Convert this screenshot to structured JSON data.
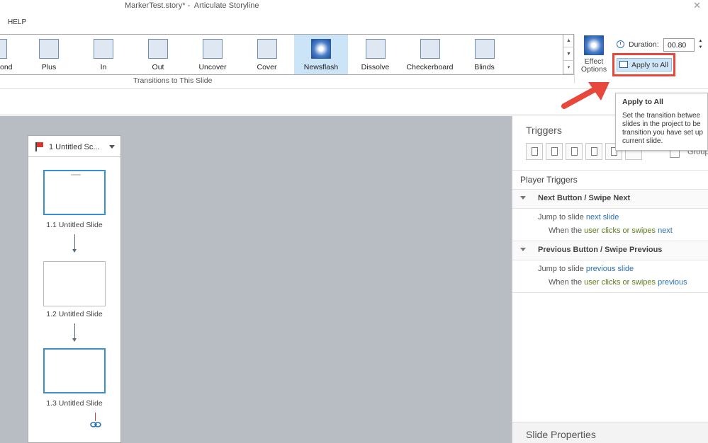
{
  "window": {
    "title": "MarkerTest.story* -  Articulate Storyline",
    "close_glyph": "✕"
  },
  "menu": {
    "help": "HELP"
  },
  "transitions": {
    "items": [
      {
        "label": "ond",
        "selected": false
      },
      {
        "label": "Plus",
        "selected": false
      },
      {
        "label": "In",
        "selected": false
      },
      {
        "label": "Out",
        "selected": false
      },
      {
        "label": "Uncover",
        "selected": false
      },
      {
        "label": "Cover",
        "selected": false
      },
      {
        "label": "Newsflash",
        "selected": true
      },
      {
        "label": "Dissolve",
        "selected": false
      },
      {
        "label": "Checkerboard",
        "selected": false
      },
      {
        "label": "Blinds",
        "selected": false
      }
    ],
    "group_label": "Transitions to This Slide",
    "scroll": [
      "▲",
      "▼",
      "▾"
    ]
  },
  "effect_options": {
    "line1": "Effect",
    "line2": "Options"
  },
  "duration": {
    "label": "Duration:",
    "value": "00.80"
  },
  "apply_to_all": {
    "label": "Apply to All"
  },
  "tooltip": {
    "title": "Apply to All",
    "lines": [
      "Set the transition betwee",
      "slides in the project to be",
      "transition you have set up",
      "current slide."
    ]
  },
  "scene": {
    "name": "1 Untitled Sc...",
    "slides": [
      {
        "label": "1.1 Untitled Slide",
        "selected": true
      },
      {
        "label": "1.2 Untitled Slide",
        "selected": false
      },
      {
        "label": "1.3 Untitled Slide",
        "selected": true
      }
    ]
  },
  "triggers_panel": {
    "title": "Triggers",
    "group_label": "Group",
    "player_triggers": "Player Triggers",
    "sections": [
      {
        "header": "Next Button / Swipe Next",
        "action_prefix": "Jump to slide ",
        "action_link": "next slide",
        "when_prefix": "When the ",
        "when_actor": "user clicks or swipes",
        "when_link": "next"
      },
      {
        "header": "Previous Button / Swipe Previous",
        "action_prefix": "Jump to slide ",
        "action_link": "previous slide",
        "when_prefix": "When the ",
        "when_actor": "user clicks or swipes",
        "when_link": "previous"
      }
    ]
  },
  "slide_properties": {
    "title": "Slide Properties"
  },
  "colors": {
    "highlight_box": "#e8473b",
    "arrow": "#e8473b",
    "link": "#2a72b5",
    "selected_tile": "#cce4f7"
  }
}
